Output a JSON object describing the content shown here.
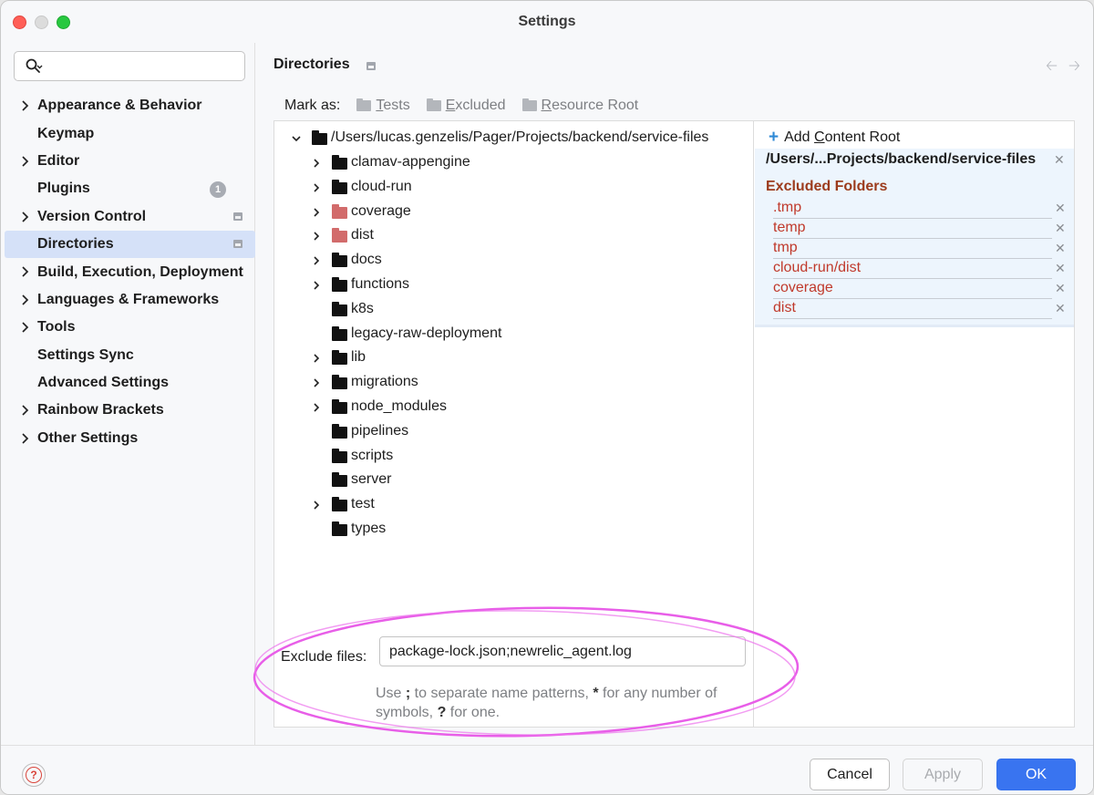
{
  "window": {
    "title": "Settings"
  },
  "search": {
    "placeholder": ""
  },
  "sidebar": {
    "items": [
      {
        "label": "Appearance & Behavior",
        "expandable": true
      },
      {
        "label": "Keymap",
        "expandable": false
      },
      {
        "label": "Editor",
        "expandable": true
      },
      {
        "label": "Plugins",
        "expandable": false,
        "badge": "1"
      },
      {
        "label": "Version Control",
        "expandable": true,
        "project_icon": true
      },
      {
        "label": "Directories",
        "expandable": false,
        "selected": true,
        "project_icon": true
      },
      {
        "label": "Build, Execution, Deployment",
        "expandable": true
      },
      {
        "label": "Languages & Frameworks",
        "expandable": true
      },
      {
        "label": "Tools",
        "expandable": true
      },
      {
        "label": "Settings Sync",
        "expandable": false
      },
      {
        "label": "Advanced Settings",
        "expandable": false
      },
      {
        "label": "Rainbow Brackets",
        "expandable": true
      },
      {
        "label": "Other Settings",
        "expandable": true
      }
    ]
  },
  "main": {
    "heading": "Directories",
    "mark_as": {
      "label": "Mark as:",
      "options": [
        {
          "label": "Tests",
          "mnemonic": "T",
          "rest": "ests"
        },
        {
          "label": "Excluded",
          "mnemonic": "E",
          "rest": "xcluded"
        },
        {
          "label": "Resource Root",
          "mnemonic": "R",
          "rest": "esource Root"
        }
      ]
    },
    "tree": {
      "root": "/Users/lucas.genzelis/Pager/Projects/backend/service-files",
      "children": [
        {
          "name": "clamav-appengine",
          "expandable": true,
          "excluded": false
        },
        {
          "name": "cloud-run",
          "expandable": true,
          "excluded": false
        },
        {
          "name": "coverage",
          "expandable": true,
          "excluded": true
        },
        {
          "name": "dist",
          "expandable": true,
          "excluded": true
        },
        {
          "name": "docs",
          "expandable": true,
          "excluded": false
        },
        {
          "name": "functions",
          "expandable": true,
          "excluded": false
        },
        {
          "name": "k8s",
          "expandable": false,
          "excluded": false
        },
        {
          "name": "legacy-raw-deployment",
          "expandable": false,
          "excluded": false
        },
        {
          "name": "lib",
          "expandable": true,
          "excluded": false
        },
        {
          "name": "migrations",
          "expandable": true,
          "excluded": false
        },
        {
          "name": "node_modules",
          "expandable": true,
          "excluded": false
        },
        {
          "name": "pipelines",
          "expandable": false,
          "excluded": false
        },
        {
          "name": "scripts",
          "expandable": false,
          "excluded": false
        },
        {
          "name": "server",
          "expandable": false,
          "excluded": false
        },
        {
          "name": "test",
          "expandable": true,
          "excluded": false
        },
        {
          "name": "types",
          "expandable": false,
          "excluded": false
        }
      ]
    },
    "exclude_files": {
      "label": "Exclude files:",
      "value": "package-lock.json;newrelic_agent.log",
      "hint_1": "Use ",
      "hint_sep": ";",
      "hint_2": " to separate name patterns, ",
      "hint_star": "*",
      "hint_3": " for any number of symbols, ",
      "hint_q": "?",
      "hint_4": " for one."
    },
    "content_roots": {
      "add_label_pre": "Add ",
      "add_label_mnemonic": "C",
      "add_label_rest": "ontent Root",
      "root_path": "/Users/...Projects/backend/service-files",
      "excluded_title": "Excluded Folders",
      "excluded": [
        ".tmp",
        "temp",
        "tmp",
        "cloud-run/dist",
        "coverage",
        "dist"
      ]
    }
  },
  "footer": {
    "help": "?",
    "cancel": "Cancel",
    "apply": "Apply",
    "ok": "OK"
  },
  "colors": {
    "accent": "#3974f0",
    "selected": "#d5e1f8",
    "excluded": "#c0392b",
    "excluded_title": "#9c3b1c",
    "annotation": "#e85ee8"
  }
}
